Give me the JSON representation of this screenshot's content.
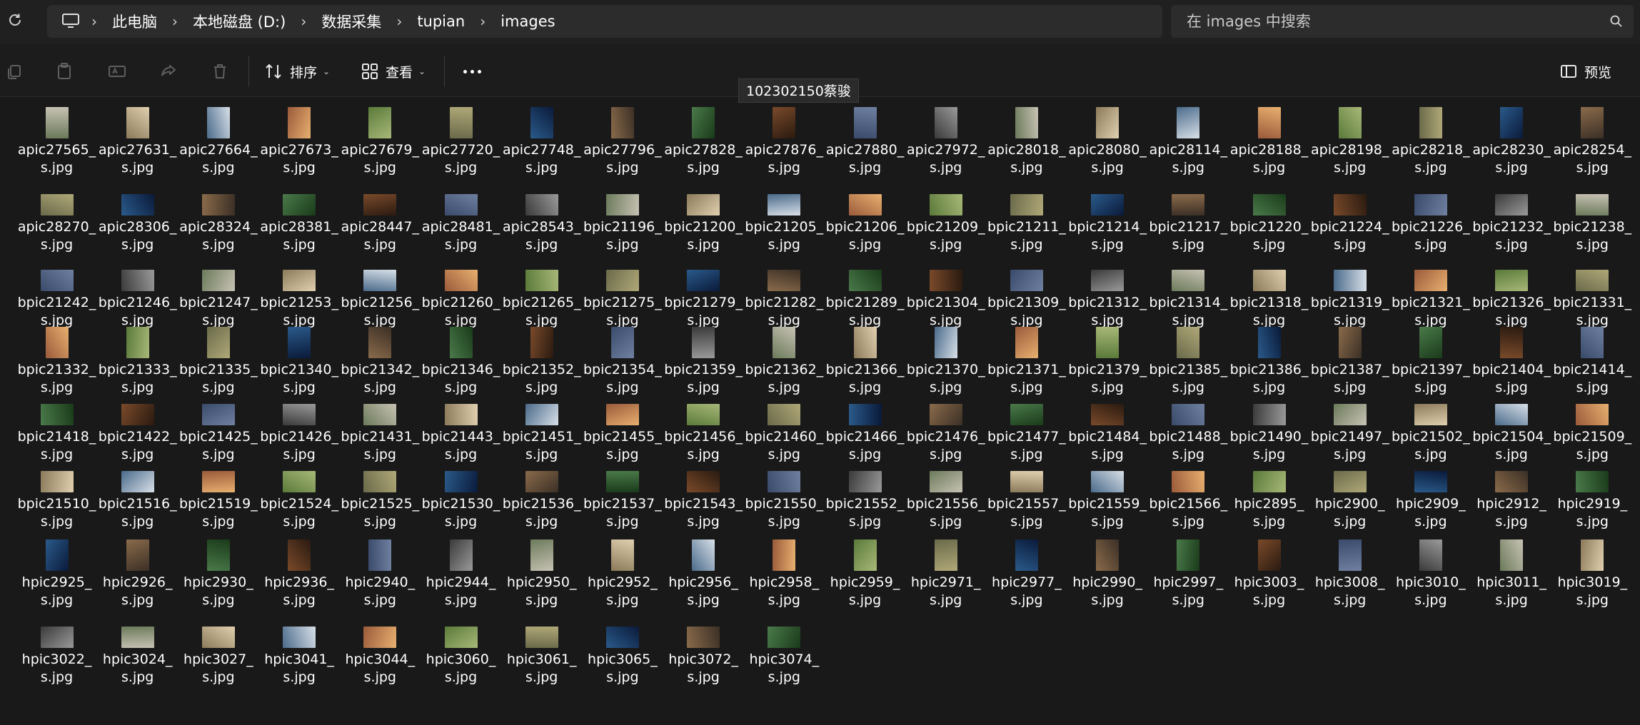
{
  "address": {
    "refresh_icon": "refresh-icon",
    "pc_icon": "monitor-icon",
    "crumbs": [
      "此电脑",
      "本地磁盘 (D:)",
      "数据采集",
      "tupian",
      "images"
    ]
  },
  "search": {
    "placeholder": "在 images 中搜索",
    "icon": "search-icon"
  },
  "toolbar": {
    "sort_label": "排序",
    "view_label": "查看",
    "preview_label": "预览",
    "icons": [
      "copy-icon",
      "paste-icon",
      "rename-icon",
      "share-icon",
      "delete-icon",
      "sort-icon",
      "view-icon",
      "more-icon",
      "preview-pane-icon"
    ]
  },
  "tooltip": "102302150蔡骏",
  "files": [
    "apic27565_s.jpg",
    "apic27631_s.jpg",
    "apic27664_s.jpg",
    "apic27673_s.jpg",
    "apic27679_s.jpg",
    "apic27720_s.jpg",
    "apic27748_s.jpg",
    "apic27796_s.jpg",
    "apic27828_s.jpg",
    "apic27876_s.jpg",
    "apic27880_s.jpg",
    "apic27972_s.jpg",
    "apic28018_s.jpg",
    "apic28080_s.jpg",
    "apic28114_s.jpg",
    "apic28188_s.jpg",
    "apic28198_s.jpg",
    "apic28218_s.jpg",
    "apic28230_s.jpg",
    "apic28254_s.jpg",
    "apic28270_s.jpg",
    "apic28306_s.jpg",
    "apic28324_s.jpg",
    "apic28381_s.jpg",
    "apic28447_s.jpg",
    "apic28481_s.jpg",
    "apic28543_s.jpg",
    "bpic21196_s.jpg",
    "bpic21200_s.jpg",
    "bpic21205_s.jpg",
    "bpic21206_s.jpg",
    "bpic21209_s.jpg",
    "bpic21211_s.jpg",
    "bpic21214_s.jpg",
    "bpic21217_s.jpg",
    "bpic21220_s.jpg",
    "bpic21224_s.jpg",
    "bpic21226_s.jpg",
    "bpic21232_s.jpg",
    "bpic21238_s.jpg",
    "bpic21242_s.jpg",
    "bpic21246_s.jpg",
    "bpic21247_s.jpg",
    "bpic21253_s.jpg",
    "bpic21256_s.jpg",
    "bpic21260_s.jpg",
    "bpic21265_s.jpg",
    "bpic21275_s.jpg",
    "bpic21279_s.jpg",
    "bpic21282_s.jpg",
    "bpic21289_s.jpg",
    "bpic21304_s.jpg",
    "bpic21309_s.jpg",
    "bpic21312_s.jpg",
    "bpic21314_s.jpg",
    "bpic21318_s.jpg",
    "bpic21319_s.jpg",
    "bpic21321_s.jpg",
    "bpic21326_s.jpg",
    "bpic21331_s.jpg",
    "bpic21332_s.jpg",
    "bpic21333_s.jpg",
    "bpic21335_s.jpg",
    "bpic21340_s.jpg",
    "bpic21342_s.jpg",
    "bpic21346_s.jpg",
    "bpic21352_s.jpg",
    "bpic21354_s.jpg",
    "bpic21359_s.jpg",
    "bpic21362_s.jpg",
    "bpic21366_s.jpg",
    "bpic21370_s.jpg",
    "bpic21371_s.jpg",
    "bpic21379_s.jpg",
    "bpic21385_s.jpg",
    "bpic21386_s.jpg",
    "bpic21387_s.jpg",
    "bpic21397_s.jpg",
    "bpic21404_s.jpg",
    "bpic21414_s.jpg",
    "bpic21418_s.jpg",
    "bpic21422_s.jpg",
    "bpic21425_s.jpg",
    "bpic21426_s.jpg",
    "bpic21431_s.jpg",
    "bpic21443_s.jpg",
    "bpic21451_s.jpg",
    "bpic21455_s.jpg",
    "bpic21456_s.jpg",
    "bpic21460_s.jpg",
    "bpic21466_s.jpg",
    "bpic21476_s.jpg",
    "bpic21477_s.jpg",
    "bpic21484_s.jpg",
    "bpic21488_s.jpg",
    "bpic21490_s.jpg",
    "bpic21497_s.jpg",
    "bpic21502_s.jpg",
    "bpic21504_s.jpg",
    "bpic21509_s.jpg",
    "bpic21510_s.jpg",
    "bpic21516_s.jpg",
    "bpic21519_s.jpg",
    "bpic21524_s.jpg",
    "bpic21525_s.jpg",
    "bpic21530_s.jpg",
    "bpic21536_s.jpg",
    "bpic21537_s.jpg",
    "bpic21543_s.jpg",
    "bpic21550_s.jpg",
    "bpic21552_s.jpg",
    "bpic21556_s.jpg",
    "bpic21557_s.jpg",
    "bpic21559_s.jpg",
    "bpic21566_s.jpg",
    "hpic2895_s.jpg",
    "hpic2900_s.jpg",
    "hpic2909_s.jpg",
    "hpic2912_s.jpg",
    "hpic2919_s.jpg",
    "hpic2925_s.jpg",
    "hpic2926_s.jpg",
    "hpic2930_s.jpg",
    "hpic2936_s.jpg",
    "hpic2940_s.jpg",
    "hpic2944_s.jpg",
    "hpic2950_s.jpg",
    "hpic2952_s.jpg",
    "hpic2956_s.jpg",
    "hpic2958_s.jpg",
    "hpic2959_s.jpg",
    "hpic2971_s.jpg",
    "hpic2977_s.jpg",
    "hpic2990_s.jpg",
    "hpic2997_s.jpg",
    "hpic3003_s.jpg",
    "hpic3008_s.jpg",
    "hpic3010_s.jpg",
    "hpic3011_s.jpg",
    "hpic3019_s.jpg",
    "hpic3022_s.jpg",
    "hpic3024_s.jpg",
    "hpic3027_s.jpg",
    "hpic3041_s.jpg",
    "hpic3044_s.jpg",
    "hpic3060_s.jpg",
    "hpic3061_s.jpg",
    "hpic3065_s.jpg",
    "hpic3072_s.jpg",
    "hpic3074_s.jpg"
  ]
}
